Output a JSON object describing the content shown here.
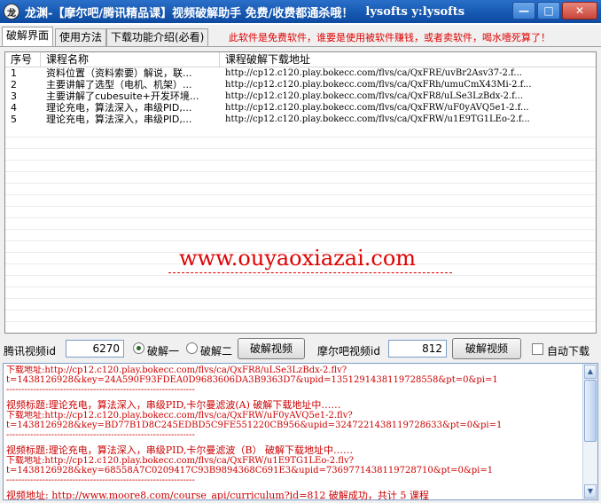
{
  "window": {
    "icon_text": "龙",
    "title": "龙渊-【摩尔吧/腾讯精品课】视频破解助手 免费/收费都通杀哦！",
    "title_right": "lysofts  y:lysofts",
    "minimize_label": "—",
    "maximize_label": "□",
    "close_label": "✕"
  },
  "tabs": [
    {
      "label": "破解界面"
    },
    {
      "label": "使用方法"
    },
    {
      "label": "下载功能介绍(必看)"
    }
  ],
  "notice": "此软件是免费软件，谁要是使用被软件赚钱，或者卖软件，喝水噎死算了！",
  "table": {
    "headers": [
      "序号",
      "课程名称",
      "课程破解下载地址"
    ],
    "rows": [
      {
        "no": "1",
        "name": "资料位置（资料索要）解说，联...",
        "url": "http://cp12.c120.play.bokecc.com/flvs/ca/QxFRE/uvBr2Asv37-2.f..."
      },
      {
        "no": "2",
        "name": "主要讲解了选型（电机、机架）...",
        "url": "http://cp12.c120.play.bokecc.com/flvs/ca/QxFRh/umuCmX43Mi-2.f..."
      },
      {
        "no": "3",
        "name": "主要讲解了cubesuite+开发环境...",
        "url": "http://cp12.c120.play.bokecc.com/flvs/ca/QxFR8/uLSe3LzBdx-2.f..."
      },
      {
        "no": "4",
        "name": "理论充电，算法深入，串级PID,...",
        "url": "http://cp12.c120.play.bokecc.com/flvs/ca/QxFRW/uF0yAVQ5e1-2.f..."
      },
      {
        "no": "5",
        "name": "理论充电，算法深入，串级PID,...",
        "url": "http://cp12.c120.play.bokecc.com/flvs/ca/QxFRW/u1E9TG1LEo-2.f..."
      }
    ]
  },
  "watermark": "www.ouyaoxiazai.com",
  "controls": {
    "tencent_label": "腾讯视频id",
    "tencent_value": "6270",
    "radio1_label": "破解一",
    "radio2_label": "破解二",
    "crack_button": "破解视频",
    "moore_label": "摩尔吧视频id",
    "moore_value": "812",
    "crack_button2": "破解视频",
    "auto_download_label": "自动下载"
  },
  "log": [
    "下载地址:http://cp12.c120.play.bokecc.com/flvs/ca/QxFR8/uLSe3LzBdx-2.flv?",
    "t=1438126928&key=24A590F93FDEA0D9683606DA3B9363D7&upid=1351291438119728558&pt=0&pi=1",
    "---------------------------------------------------------------",
    "视频标题:理论充电，算法深入，串级PID,卡尔曼滤波(A) 破解下载地址中……",
    "下载地址:http://cp12.c120.play.bokecc.com/flvs/ca/QxFRW/uF0yAVQ5e1-2.flv?",
    "t=1438126928&key=BD77B1D8C245EDBD5C9FE551220CB956&upid=3247221438119728633&pt=0&pi=1",
    "---------------------------------------------------------------",
    "视频标题:理论充电，算法深入，串级PID,卡尔曼滤波（B） 破解下载地址中……",
    "下载地址:http://cp12.c120.play.bokecc.com/flvs/ca/QxFRW/u1E9TG1LEo-2.flv?",
    "t=1438126928&key=68558A7C0209417C93B9894368C691E3&upid=7369771438119728710&pt=0&pi=1",
    "---------------------------------------------------------------",
    "视频地址: http://www.moore8.com/course_api/curriculum?id=812 破解成功，共计 5 课程"
  ],
  "colors": {
    "title_bar": "#1557b0",
    "accent_red": "#e00000"
  },
  "icons": {
    "app": "app-logo-icon",
    "scroll_up": "chevron-up-icon",
    "scroll_down": "chevron-down-icon"
  }
}
